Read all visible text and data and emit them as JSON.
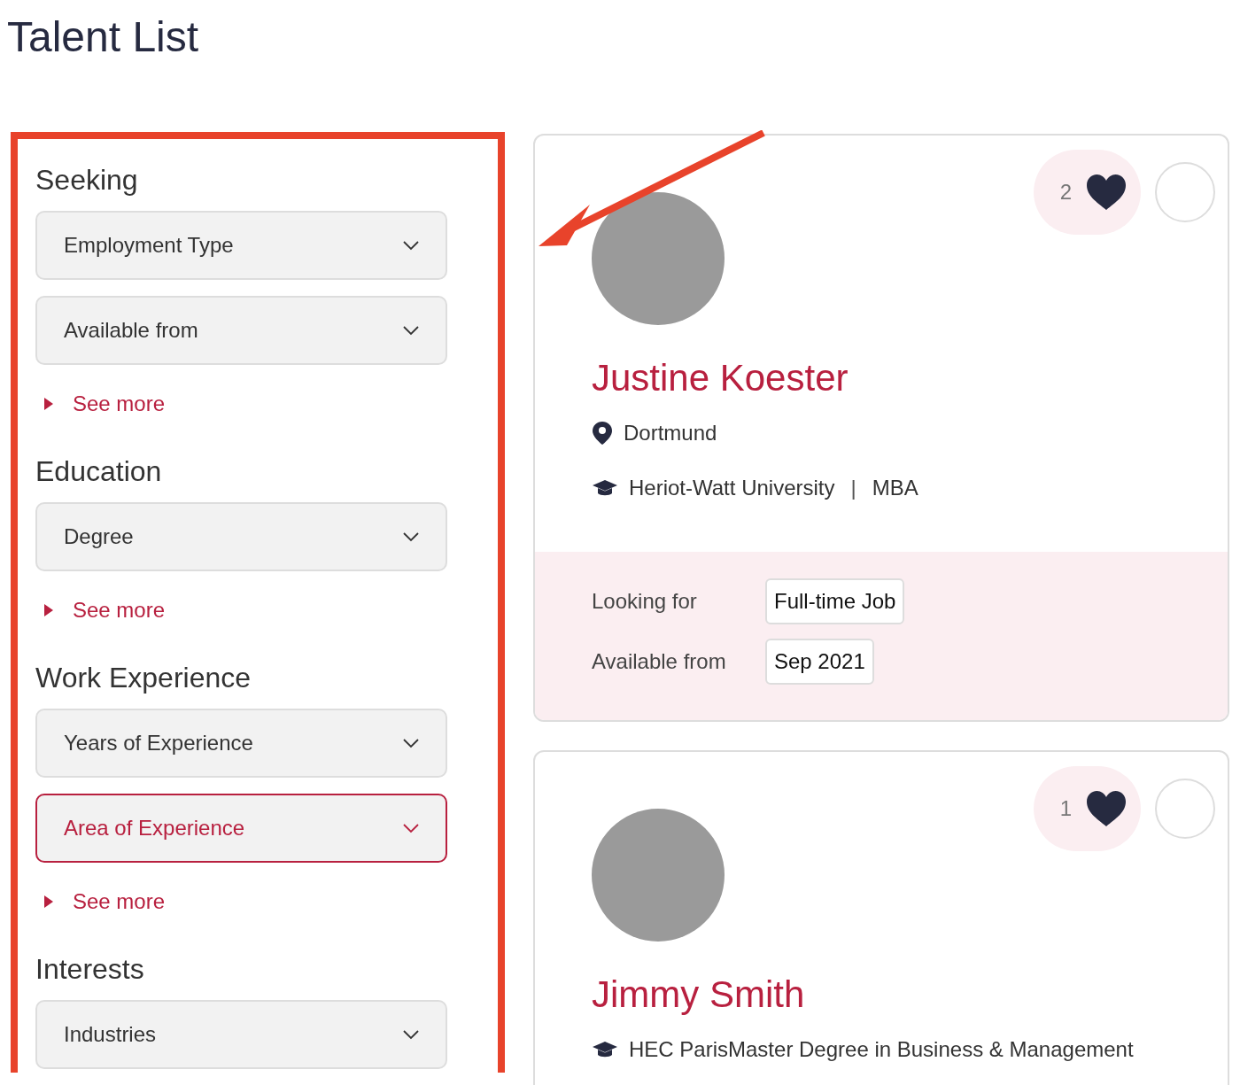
{
  "title": "Talent List",
  "filter_sections": [
    {
      "heading": "Seeking",
      "dropdowns": [
        {
          "label": "Employment Type",
          "active": false
        },
        {
          "label": "Available from",
          "active": false
        }
      ],
      "see_more": "See more"
    },
    {
      "heading": "Education",
      "dropdowns": [
        {
          "label": "Degree",
          "active": false
        }
      ],
      "see_more": "See more"
    },
    {
      "heading": "Work Experience",
      "dropdowns": [
        {
          "label": "Years of Experience",
          "active": false
        },
        {
          "label": "Area of Experience",
          "active": true
        }
      ],
      "see_more": "See more"
    },
    {
      "heading": "Interests",
      "dropdowns": [
        {
          "label": "Industries",
          "active": false
        }
      ]
    }
  ],
  "cards": [
    {
      "likes": "2",
      "selected": false,
      "name": "Justine Koester",
      "location": "Dortmund",
      "school": "Heriot-Watt University",
      "separator": "|",
      "degree": "MBA",
      "details": [
        {
          "label": "Looking for",
          "value": "Full-time Job"
        },
        {
          "label": "Available from",
          "value": "Sep 2021"
        }
      ]
    },
    {
      "likes": "1",
      "selected": false,
      "name": "Jimmy Smith",
      "school": "HEC ParisMaster Degree in Business & Management"
    }
  ]
}
